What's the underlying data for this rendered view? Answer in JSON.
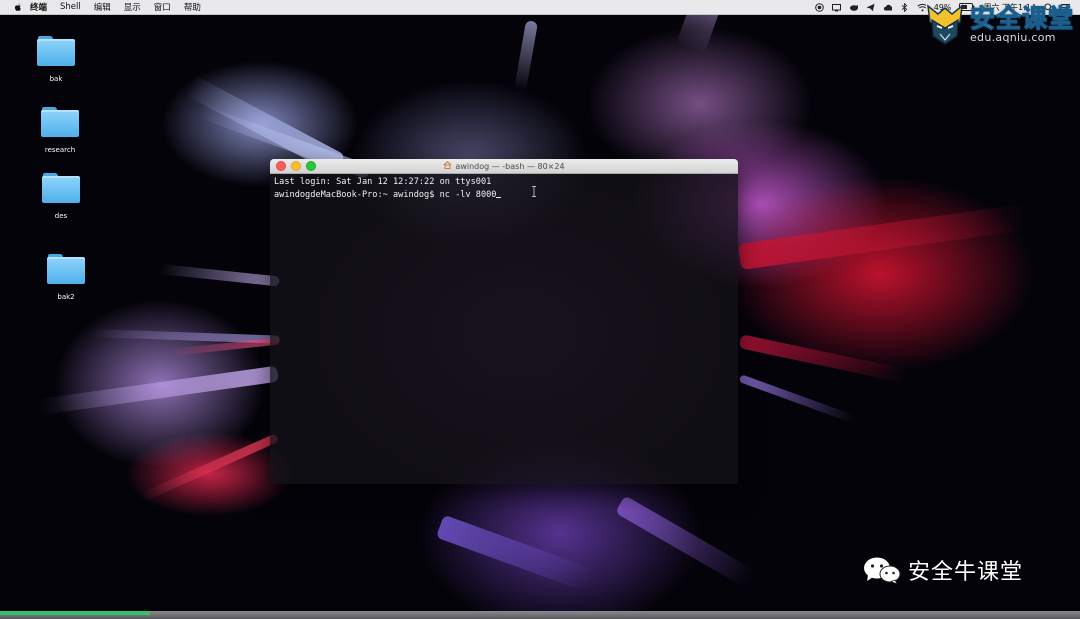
{
  "menubar": {
    "apple_icon": "apple-logo",
    "items": [
      "终端",
      "Shell",
      "编辑",
      "显示",
      "窗口",
      "帮助"
    ],
    "status": {
      "battery": "49%",
      "clock": "周六 下午1:14",
      "icons": [
        "record-icon",
        "screen-icon",
        "sheep-icon",
        "send-icon",
        "cloud-icon",
        "bluetooth-icon",
        "battery-icon",
        "wifi-icon"
      ]
    }
  },
  "desktop": {
    "icons": [
      {
        "label": "bak"
      },
      {
        "label": "research"
      },
      {
        "label": "des"
      },
      {
        "label": "bak2"
      }
    ]
  },
  "terminal": {
    "title": "awindog — -bash — 80×24",
    "lines": [
      "Last login: Sat Jan 12 12:27:22 on ttys001",
      "awindogdeMacBook-Pro:~ awindog$ nc -lv 8000"
    ]
  },
  "watermark": {
    "top_title": "安全课堂",
    "top_url": "edu.aqniu.com",
    "bottom_name": "安全牛课堂"
  },
  "colors": {
    "menubar_bg": "#e9e8ea",
    "folder": "#5fb9f0",
    "close": "#fc5f57",
    "minimize": "#fdbc2e",
    "zoom": "#28c840"
  }
}
